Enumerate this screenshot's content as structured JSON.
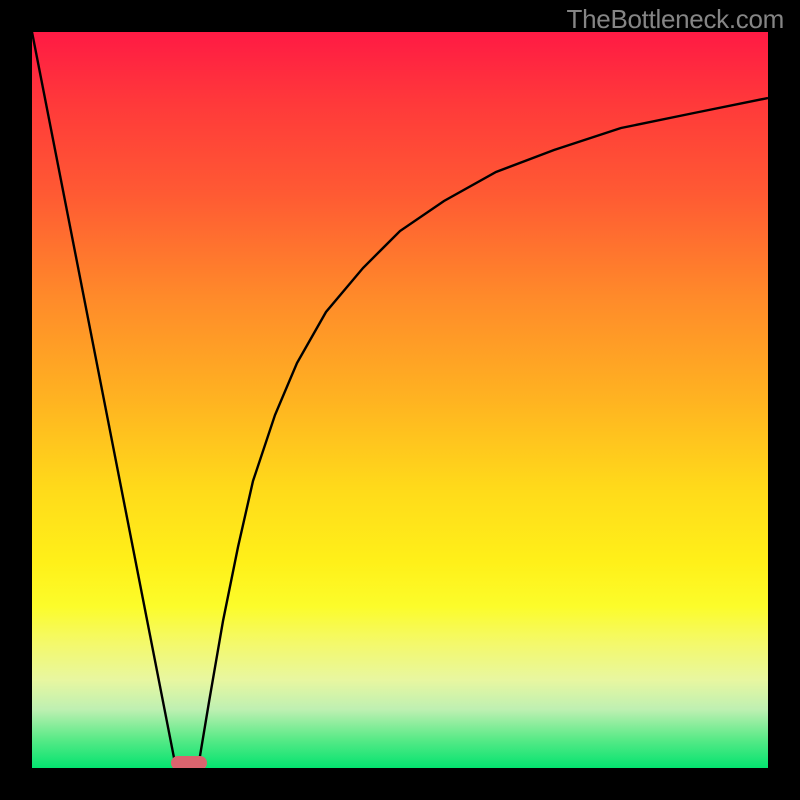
{
  "watermark": "TheBottleneck.com",
  "chart_data": {
    "type": "line",
    "title": "",
    "xlabel": "",
    "ylabel": "",
    "xlim": [
      0,
      100
    ],
    "ylim": [
      0,
      100
    ],
    "grid": false,
    "legend": false,
    "series": [
      {
        "name": "left-branch",
        "x": [
          0,
          2,
          4,
          6,
          8,
          10,
          12,
          14,
          16,
          18,
          19.5
        ],
        "values": [
          100,
          90,
          80,
          70,
          60,
          50,
          39,
          29,
          18,
          7,
          0
        ]
      },
      {
        "name": "right-branch",
        "x": [
          22.5,
          24,
          26,
          28,
          30,
          33,
          36,
          40,
          45,
          50,
          56,
          63,
          71,
          80,
          90,
          100
        ],
        "values": [
          0,
          9,
          20,
          30,
          39,
          48,
          55,
          62,
          68,
          73,
          77,
          81,
          84,
          87,
          89,
          91
        ]
      }
    ],
    "marker": {
      "name": "bottleneck-marker",
      "x_center": 21,
      "width": 4,
      "y": 0,
      "color": "#d9646e"
    },
    "background_gradient": {
      "stops": [
        {
          "pct": 0,
          "color": "#ff1a44"
        },
        {
          "pct": 50,
          "color": "#ffb321"
        },
        {
          "pct": 80,
          "color": "#fcfc2a"
        },
        {
          "pct": 100,
          "color": "#03e36f"
        }
      ]
    }
  }
}
